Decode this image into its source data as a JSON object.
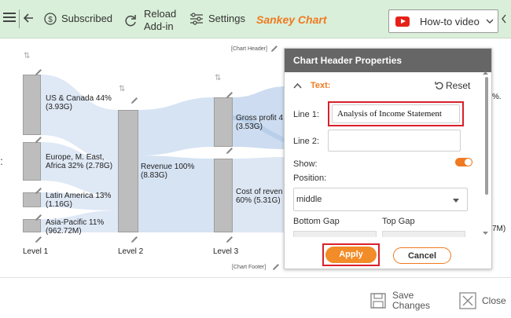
{
  "toolbar": {
    "subscribed_label": "Subscribed",
    "reload_label_1": "Reload",
    "reload_label_2": "Add-in",
    "settings_label": "Settings",
    "title": "Sankey Chart",
    "howto_label": "How-to video"
  },
  "chart": {
    "header_tag": "[Chart Header]",
    "footer_tag": "[Chart Footer]",
    "levels": [
      "Level 1",
      "Level 2",
      "Level 3"
    ],
    "nodes": {
      "us_1": "US & Canada 44%",
      "us_2": "(3.93G)",
      "eu_1": "Europe, M. East,",
      "eu_2": "Africa 32% (2.78G)",
      "la_1": "Latin America 13%",
      "la_2": "(1.16G)",
      "ap_1": "Asia-Pacific 11%",
      "ap_2": "(962.72M)",
      "rev_1": "Revenue 100%",
      "rev_2": "(8.83G)",
      "gp_1": "Gross profit 4",
      "gp_2": "(3.53G)",
      "cr_1": "Cost of reven",
      "cr_2": "60% (5.31G)"
    },
    "right_edge_pct": "%.",
    "right_edge_val": "7M)"
  },
  "panel": {
    "title": "Chart Header Properties",
    "section": "Text:",
    "reset_label": "Reset",
    "line1_label": "Line 1:",
    "line1_value": "Analysis of Income Statement",
    "line2_label": "Line 2:",
    "line2_value": "",
    "show_label": "Show:",
    "show_on": true,
    "position_label": "Position:",
    "position_value": "middle",
    "bottom_gap_label": "Bottom Gap",
    "top_gap_label": "Top Gap",
    "apply_label": "Apply",
    "cancel_label": "Cancel"
  },
  "footer": {
    "save_1": "Save",
    "save_2": "Changes",
    "close_label": "Close"
  },
  "colors": {
    "toolbar_bg": "#d9efd9",
    "accent": "#f07a1f",
    "highlight": "#d9202c",
    "flow": "#d3e1f3"
  }
}
